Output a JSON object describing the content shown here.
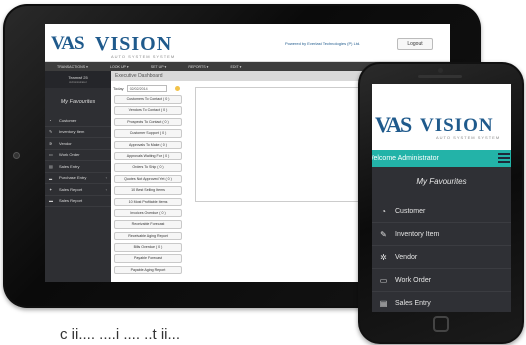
{
  "tablet": {
    "header": {
      "logo_mark": "VAS",
      "logo_text": "VISION",
      "logo_sub": "AUTO SYSTEM SYSTEM",
      "powered_by": "Powered by Everlast Technologies (P) Ltd.",
      "logout_label": "Logout"
    },
    "nav": [
      "TRANSACTIONS ▾",
      "LOOK UP ▾",
      "SET UP ▾",
      "REPORTS ▾",
      "EDIT ▾"
    ],
    "sidebar": {
      "user_name": "Teamwf 25",
      "user_role": "Administrator",
      "favourites_title": "My Favourites",
      "items": [
        {
          "label": "Customer",
          "icon": "speedometer-icon",
          "glyph": "◔",
          "arrow": ""
        },
        {
          "label": "Inventory Item",
          "icon": "pencil-icon",
          "glyph": "✎",
          "arrow": ""
        },
        {
          "label": "Vendor",
          "icon": "gear-icon",
          "glyph": "✲",
          "arrow": ""
        },
        {
          "label": "Work Order",
          "icon": "monitor-icon",
          "glyph": "▭",
          "arrow": ""
        },
        {
          "label": "Sales Entry",
          "icon": "table-icon",
          "glyph": "▤",
          "arrow": ""
        },
        {
          "label": "Purchase Entry",
          "icon": "chart-icon",
          "glyph": "▂",
          "arrow": "‹"
        },
        {
          "label": "Sales Report",
          "icon": "tag-icon",
          "glyph": "✦",
          "arrow": "‹"
        },
        {
          "label": "Sales Report",
          "icon": "folder-icon",
          "glyph": "▬",
          "arrow": ""
        }
      ]
    },
    "main": {
      "title": "Executive Dashboard",
      "today_label": "Today",
      "today_value": "02/02/2014",
      "buttons": [
        "Customers To Contact ( 0 )",
        "Vendors To Contact ( 0 )",
        "Prospects To Contact ( 0 )",
        "Customer Support ( 0 )",
        "Approvals To Make ( 0 )",
        "Approvals Waiting For ( 0 )",
        "Orders To Ship ( 0 )",
        "Quotes Not Approved Yet ( 0 )",
        "10 Best Selling Items",
        "10 Most Profitable Items",
        "Invoices Overdue ( 0 )",
        "Receivable Forecast",
        "Receivable Aging Report",
        "Bills Overdue ( 0 )",
        "Payable Forecast",
        "Payable Aging Report"
      ]
    }
  },
  "phone": {
    "logo_mark": "VAS",
    "logo_text": "VISION",
    "logo_sub": "AUTO SYSTEM SYSTEM",
    "welcome": "Welcome Administrator",
    "favourites_title": "My Favourites",
    "items": [
      {
        "label": "Customer",
        "icon": "speedometer-icon",
        "glyph": "◔"
      },
      {
        "label": "Inventory Item",
        "icon": "pencil-icon",
        "glyph": "✎"
      },
      {
        "label": "Vendor",
        "icon": "gear-icon",
        "glyph": "✲"
      },
      {
        "label": "Work Order",
        "icon": "monitor-icon",
        "glyph": "▭"
      },
      {
        "label": "Sales Entry",
        "icon": "table-icon",
        "glyph": "▤"
      }
    ]
  },
  "caption": "c  ii.... ....i  .... ..t ii...",
  "colors": {
    "accent": "#23b3a8",
    "brand": "#1f5a8c",
    "sidebar": "#2e2f33"
  }
}
